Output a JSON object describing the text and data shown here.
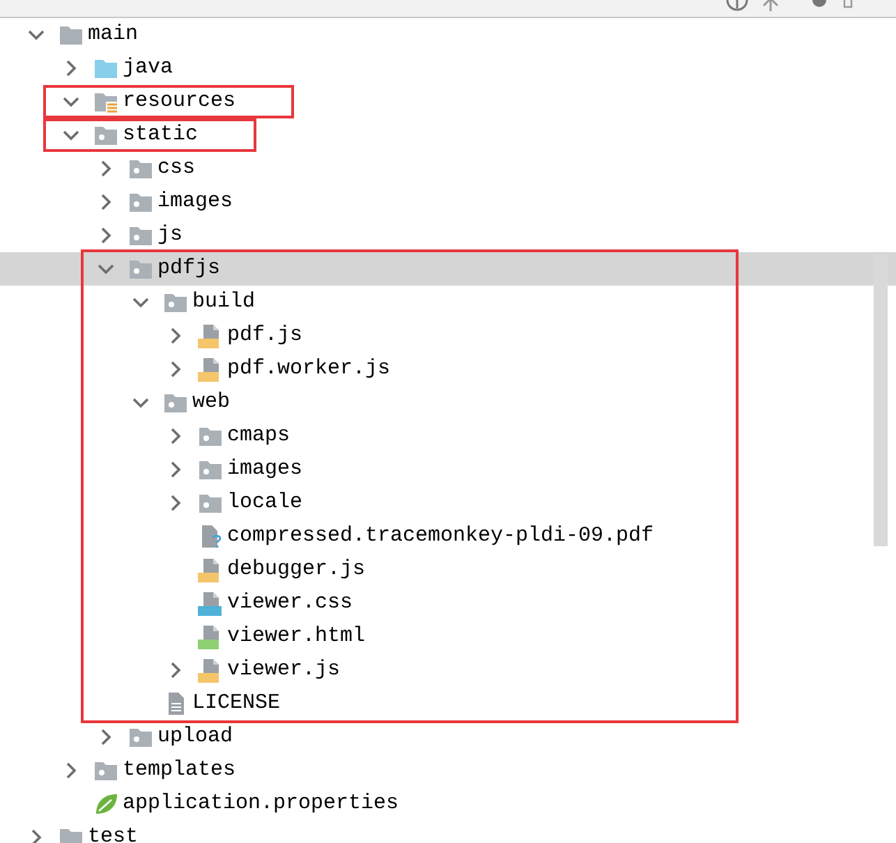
{
  "tree": [
    {
      "label": "main",
      "kind": "folder",
      "expanded": true,
      "children": [
        {
          "label": "java",
          "kind": "source-folder",
          "expanded": false
        },
        {
          "label": "resources",
          "kind": "resources-folder",
          "expanded": true,
          "boxed": true
        },
        {
          "label": "static",
          "kind": "package",
          "expanded": true,
          "boxed": true,
          "children": [
            {
              "label": "css",
              "kind": "package",
              "expanded": false
            },
            {
              "label": "images",
              "kind": "package",
              "expanded": false
            },
            {
              "label": "js",
              "kind": "package",
              "expanded": false
            },
            {
              "label": "pdfjs",
              "kind": "package",
              "expanded": true,
              "selected": true,
              "boxed": true,
              "box_covers_children": true,
              "children": [
                {
                  "label": "build",
                  "kind": "package",
                  "expanded": true,
                  "children": [
                    {
                      "label": "pdf.js",
                      "kind": "js",
                      "expanded": false
                    },
                    {
                      "label": "pdf.worker.js",
                      "kind": "js",
                      "expanded": false
                    }
                  ]
                },
                {
                  "label": "web",
                  "kind": "package",
                  "expanded": true,
                  "children": [
                    {
                      "label": "cmaps",
                      "kind": "package",
                      "expanded": false
                    },
                    {
                      "label": "images",
                      "kind": "package",
                      "expanded": false
                    },
                    {
                      "label": "locale",
                      "kind": "package",
                      "expanded": false
                    },
                    {
                      "label": "compressed.tracemonkey-pldi-09.pdf",
                      "kind": "unknown"
                    },
                    {
                      "label": "debugger.js",
                      "kind": "js"
                    },
                    {
                      "label": "viewer.css",
                      "kind": "css"
                    },
                    {
                      "label": "viewer.html",
                      "kind": "html"
                    },
                    {
                      "label": "viewer.js",
                      "kind": "js",
                      "expanded": false
                    }
                  ]
                },
                {
                  "label": "LICENSE",
                  "kind": "text"
                }
              ]
            },
            {
              "label": "upload",
              "kind": "package",
              "expanded": false
            }
          ]
        },
        {
          "label": "templates",
          "kind": "package",
          "expanded": false
        },
        {
          "label": "application.properties",
          "kind": "properties"
        }
      ]
    },
    {
      "label": "test",
      "kind": "folder",
      "expanded": false
    }
  ]
}
